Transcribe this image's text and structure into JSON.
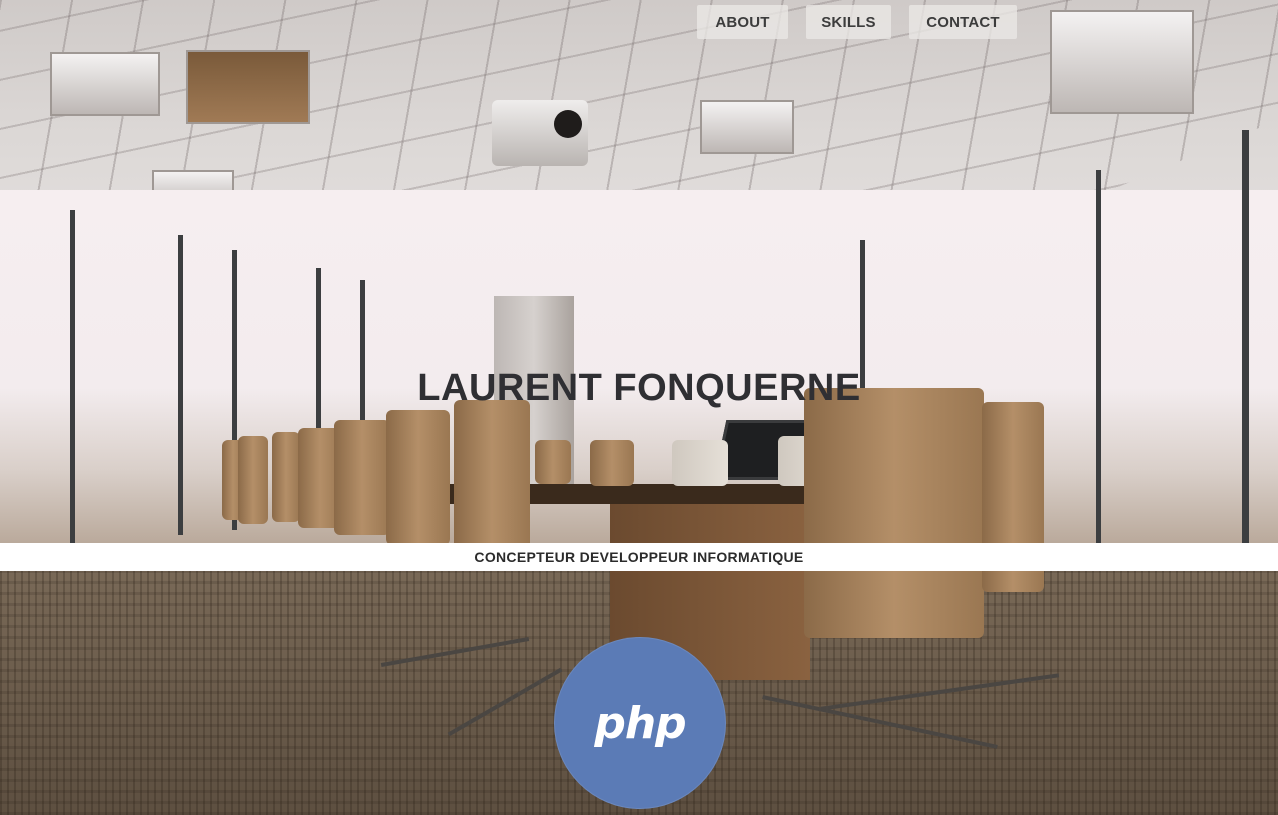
{
  "nav": {
    "items": [
      {
        "label": "ABOUT"
      },
      {
        "label": "SKILLS"
      },
      {
        "label": "CONTACT"
      }
    ]
  },
  "hero": {
    "name": "LAURENT FONQUERNE",
    "subtitle": "CONCEPTEUR DEVELOPPEUR INFORMATIQUE"
  },
  "skill_badge": {
    "label": "php",
    "icon": "php-logo",
    "color": "#5b7bb6"
  },
  "background": {
    "icon": "office-meeting-room-photo"
  }
}
